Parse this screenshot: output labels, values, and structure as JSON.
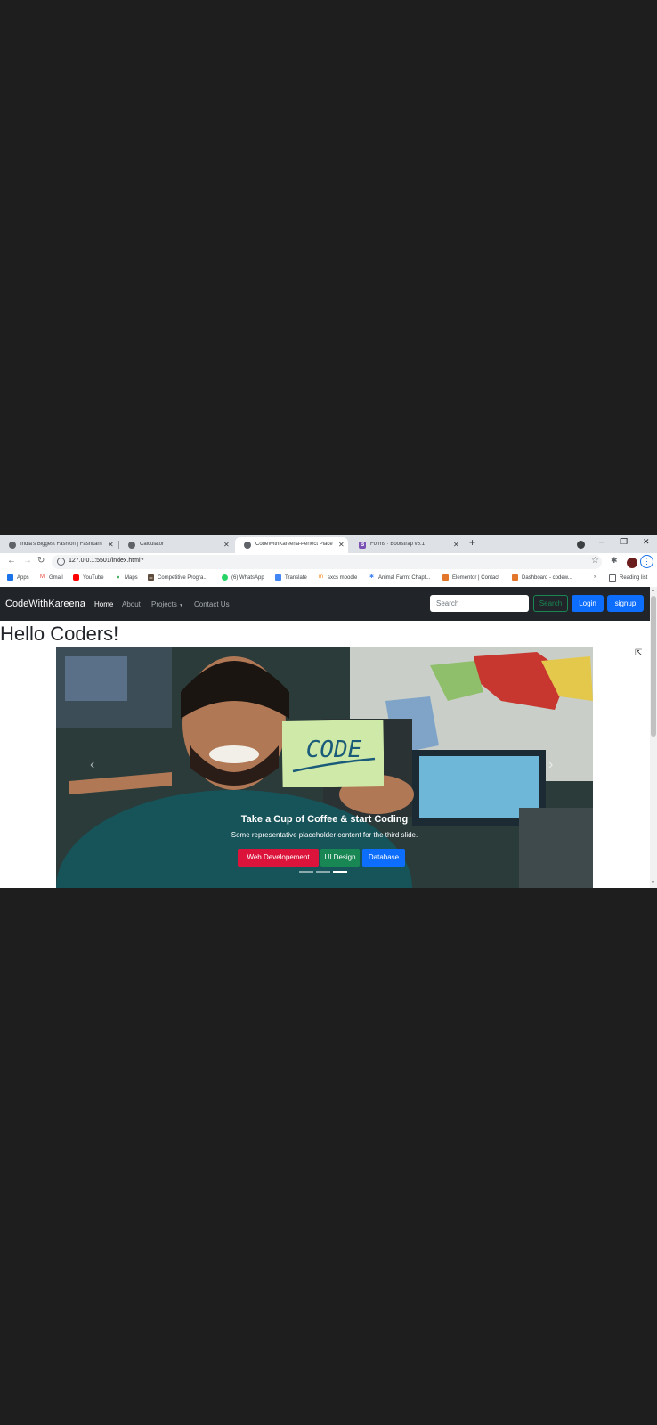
{
  "browser": {
    "tabs": [
      {
        "title": "India's Biggest Fashion | Fashkarn",
        "active": false
      },
      {
        "title": "Calculator",
        "active": false
      },
      {
        "title": "CodeWithKareena-Perfect Place",
        "active": true
      },
      {
        "title": "Forms · Bootstrap v5.1",
        "active": false
      }
    ],
    "new_tab": "+",
    "window_controls": {
      "minimize": "–",
      "restore": "❐",
      "close": "✕"
    },
    "url": "127.0.0.1:5501/index.html?",
    "bookmarks": [
      {
        "label": "Apps",
        "icon": "apps-grid-icon",
        "color": "#1a73e8"
      },
      {
        "label": "Gmail",
        "icon": "gmail-icon",
        "color": "#ea4335"
      },
      {
        "label": "YouTube",
        "icon": "youtube-icon",
        "color": "#ff0000"
      },
      {
        "label": "Maps",
        "icon": "maps-pin-icon",
        "color": "#34a853"
      },
      {
        "label": "Competitive Progra...",
        "icon": "cc-icon",
        "color": "#5f4b3b"
      },
      {
        "label": "(6) WhatsApp",
        "icon": "whatsapp-icon",
        "color": "#25d366"
      },
      {
        "label": "Translate",
        "icon": "translate-icon",
        "color": "#4285f4"
      },
      {
        "label": "sxcs moodle",
        "icon": "moodle-icon",
        "color": "#f98012"
      },
      {
        "label": "Animal Farm: Chapt...",
        "icon": "snowflake-icon",
        "color": "#4285f4"
      },
      {
        "label": "Elementor | Contact",
        "icon": "elementor-icon",
        "color": "#e2762b"
      },
      {
        "label": "Dashboard - codew...",
        "icon": "dashboard-icon",
        "color": "#e2762b"
      }
    ],
    "bookmarks_overflow": "»",
    "reading_list": "Reading list"
  },
  "site": {
    "brand": "CodeWithKareena",
    "nav": [
      {
        "label": "Home",
        "active": true
      },
      {
        "label": "About",
        "active": false
      },
      {
        "label": "Projects",
        "active": false,
        "dropdown": true
      },
      {
        "label": "Contact Us",
        "active": false
      }
    ],
    "search_placeholder": "Search",
    "search_button": "Search",
    "login_button": "Login",
    "signup_button": "signup",
    "heading": "Hello Coders!",
    "carousel": {
      "note_text": "CODE",
      "caption_title": "Take a Cup of Coffee & start Coding",
      "caption_text": "Some representative placeholder content for the third slide.",
      "buttons": [
        {
          "label": "Web Developement",
          "color": "#dc143c"
        },
        {
          "label": "UI Design",
          "color": "#198754"
        },
        {
          "label": "Database",
          "color": "#0d6efd"
        }
      ],
      "active_slide": 3,
      "slide_count": 3
    }
  }
}
